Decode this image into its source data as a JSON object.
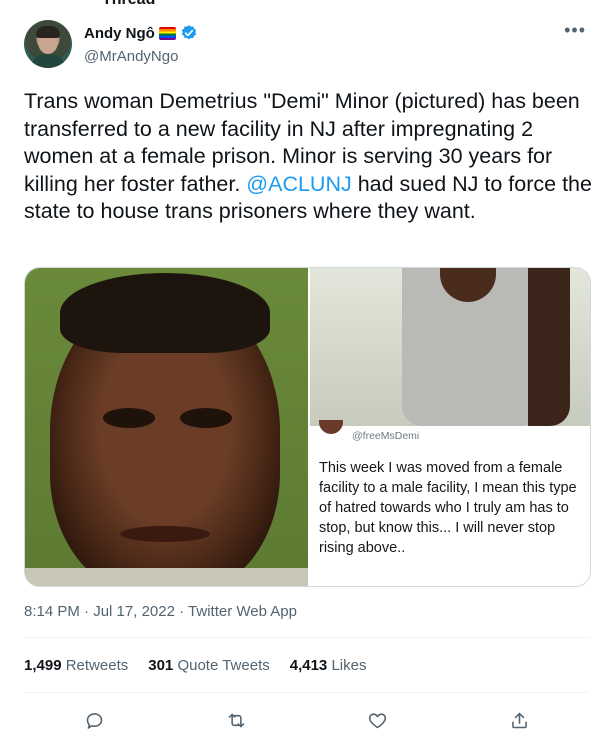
{
  "header": {
    "cut_label": "Thread",
    "display_name": "Andy Ngô",
    "handle": "@MrAndyNgo",
    "more_label": "•••"
  },
  "tweet": {
    "text_before": "Trans woman Demetrius \"Demi\" Minor (pictured) has been transferred to a new facility in NJ after impregnating 2 women at a female prison. Minor is serving 30 years for killing her foster father. ",
    "mention": "@ACLUNJ",
    "text_after": " had sued NJ to force the state to house trans prisoners where they want."
  },
  "embedded": {
    "handle": "@freeMsDemi",
    "text": "This week I was moved from a female facility to a male facility, I mean this type of hatred towards who I truly am has to stop, but know this... I will never stop rising above.."
  },
  "meta": {
    "time": "8:14 PM",
    "dot1": "·",
    "date": "Jul 17, 2022",
    "dot2": "·",
    "client": "Twitter Web App"
  },
  "stats": {
    "retweets_count": "1,499",
    "retweets_label": "Retweets",
    "quotes_count": "301",
    "quotes_label": "Quote Tweets",
    "likes_count": "4,413",
    "likes_label": "Likes"
  },
  "colors": {
    "accent": "#1d9bf0",
    "secondary_text": "#536471",
    "border": "#cfd9de"
  },
  "icons": [
    "reply-icon",
    "retweet-icon",
    "like-icon",
    "share-icon",
    "verified-badge-icon",
    "rainbow-flag-icon"
  ]
}
